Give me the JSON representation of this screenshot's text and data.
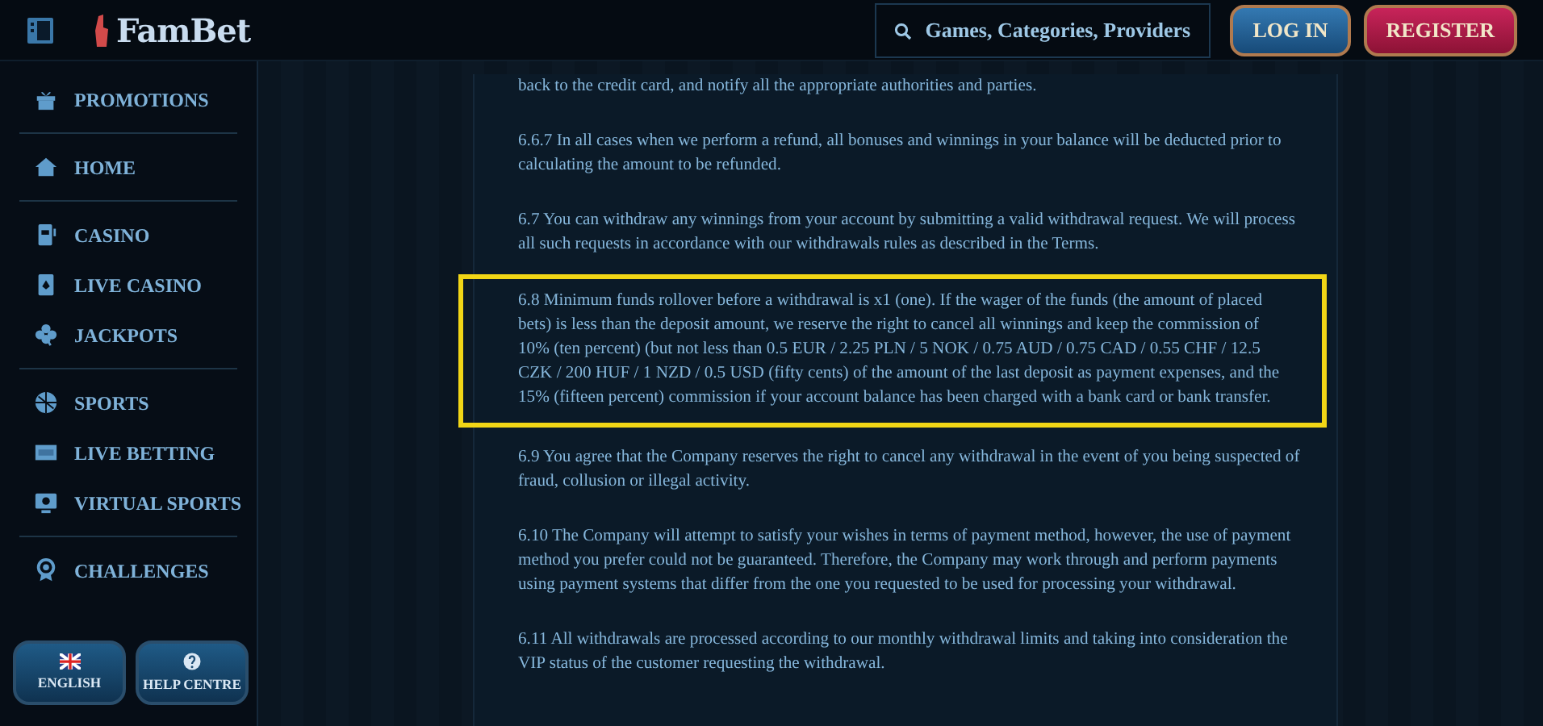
{
  "header": {
    "logo": "FamBet",
    "search": {
      "placeholder": "Games, Categories, Providers"
    },
    "buttons": [
      {
        "label": "LOG IN",
        "kind": "login"
      },
      {
        "label": "REGISTER",
        "kind": "register"
      }
    ]
  },
  "sidebar": {
    "groups": [
      [
        {
          "label": "PROMOTIONS"
        }
      ],
      [
        {
          "label": "HOME"
        }
      ],
      [
        {
          "label": "CASINO"
        },
        {
          "label": "LIVE CASINO"
        },
        {
          "label": "JACKPOTS"
        }
      ],
      [
        {
          "label": "SPORTS"
        },
        {
          "label": "LIVE BETTING"
        },
        {
          "label": "VIRTUAL SPORTS"
        }
      ],
      [
        {
          "label": "CHALLENGES"
        }
      ]
    ],
    "footer_buttons": [
      {
        "label": "ENGLISH"
      },
      {
        "label": "HELP CENTRE"
      }
    ]
  },
  "paragraphs": [
    {
      "text": "back to the credit card, and notify all the appropriate authorities and parties.",
      "highlighted": false
    },
    {
      "text": "6.6.7 In all cases when we perform a refund, all bonuses and winnings in your balance will be deducted prior to calculating the amount to be refunded.",
      "highlighted": false
    },
    {
      "text": "6.7 You can withdraw any winnings from your account by submitting a valid withdrawal request. We will process all such requests in accordance with our withdrawals rules as described in the Terms.",
      "highlighted": false
    },
    {
      "text": "6.8 Minimum funds rollover before a withdrawal is x1 (one). If the wager of the funds (the amount of placed bets) is less than the deposit amount, we reserve the right to cancel all winnings and keep the commission of 10% (ten percent) (but not less than 0.5 EUR / 2.25 PLN / 5 NOK / 0.75 AUD / 0.75 CAD / 0.55 CHF / 12.5 CZK / 200 HUF / 1 NZD / 0.5 USD (fifty cents) of the amount of the last deposit as payment expenses, and the 15% (fifteen percent) commission if your account balance has been charged with a bank card or bank transfer.",
      "highlighted": true
    },
    {
      "text": "6.9 You agree that the Company reserves the right to cancel any withdrawal in the event of you being suspected of fraud, collusion or illegal activity.",
      "highlighted": false
    },
    {
      "text": "6.10 The Company will attempt to satisfy your wishes in terms of payment method, however, the use of payment method you prefer could not be guaranteed. Therefore, the Company may work through and perform payments using payment systems that differ from the one you requested to be used for processing your withdrawal.",
      "highlighted": false
    },
    {
      "text": "6.11 All withdrawals are processed according to our monthly withdrawal limits and taking into consideration the VIP status of the customer requesting the withdrawal.",
      "highlighted": false
    }
  ]
}
